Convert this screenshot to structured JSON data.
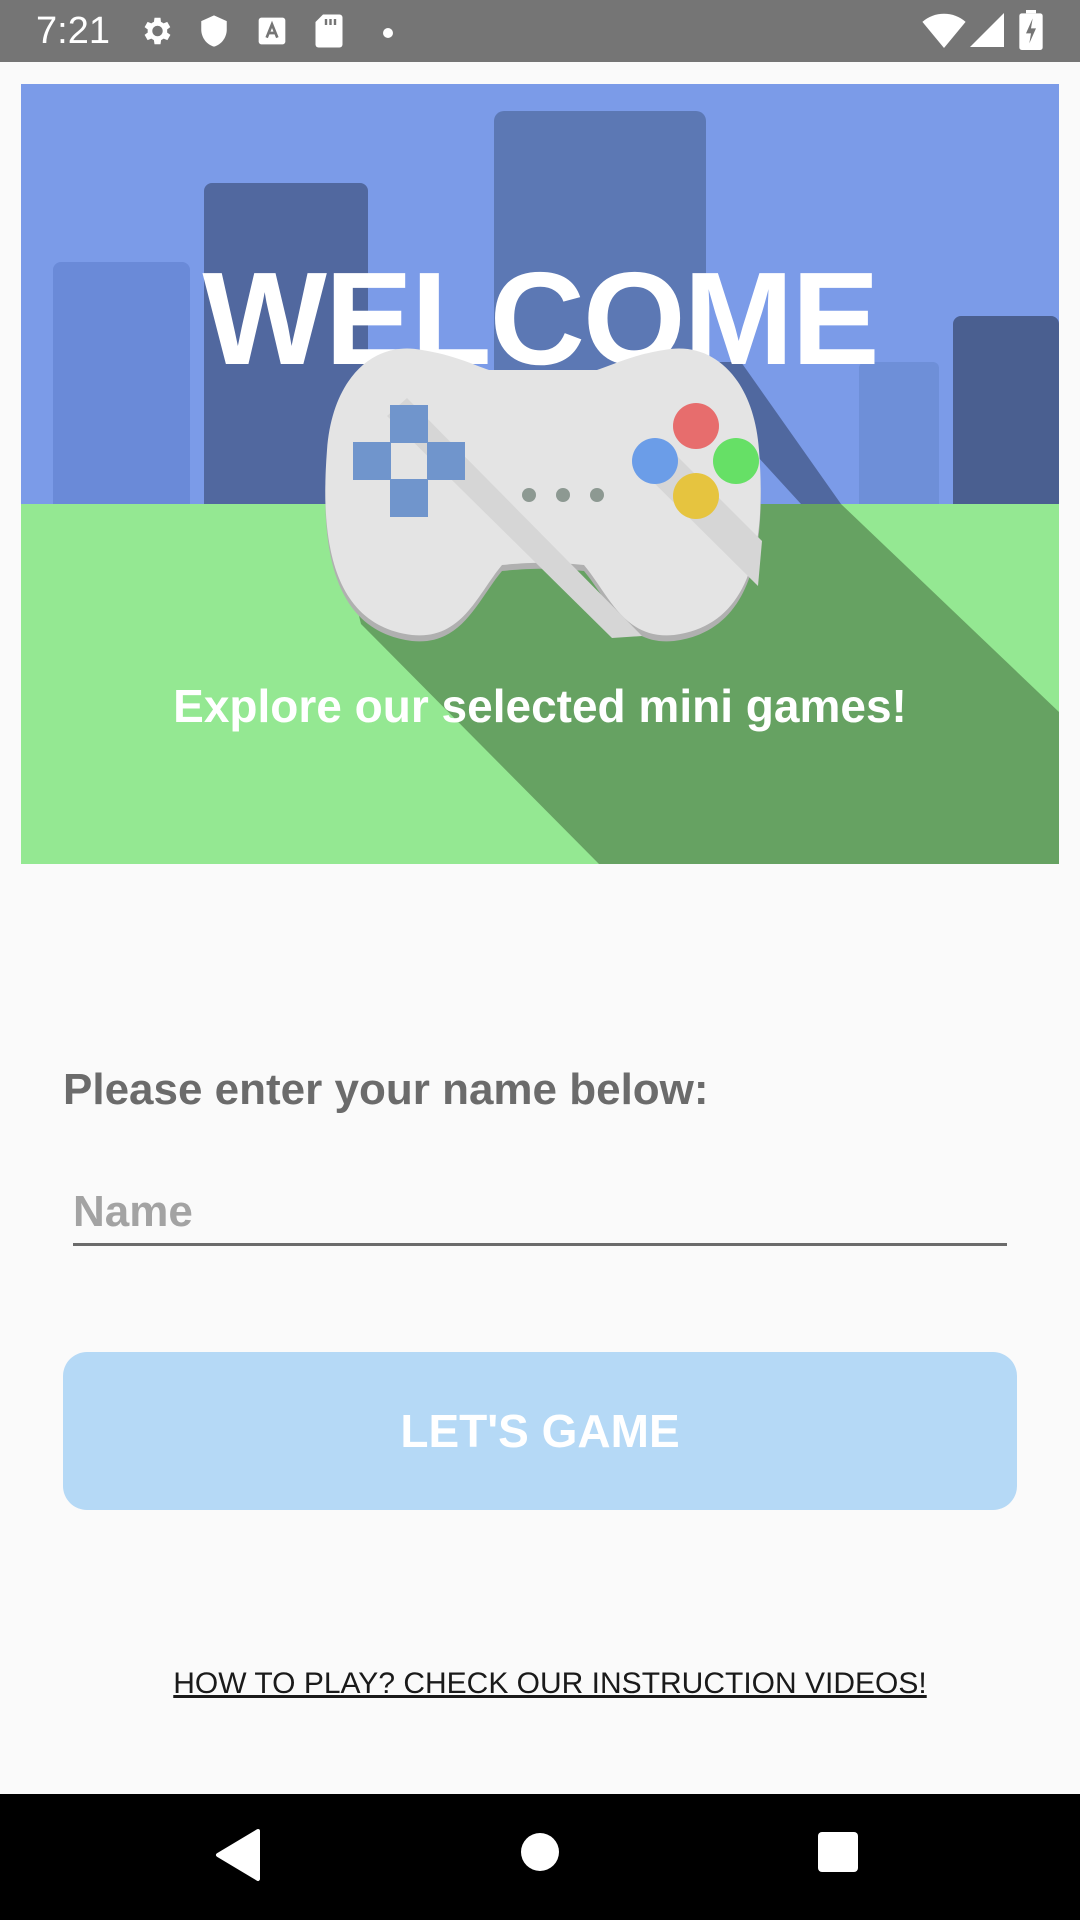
{
  "status_bar": {
    "time": "7:21",
    "left_icons": [
      "gear-icon",
      "shield-icon",
      "font-a-icon",
      "sd-card-icon",
      "dot-icon"
    ],
    "right_icons": [
      "wifi-icon",
      "cell-signal-icon",
      "battery-charging-icon"
    ]
  },
  "hero": {
    "title": "WELCOME",
    "tagline": "Explore our selected mini games!",
    "colors": {
      "sky": "#7b9be8",
      "grass": "#94e892",
      "shadow": "#66a262"
    },
    "illustration": "gamepad-icon"
  },
  "form": {
    "prompt": "Please enter your name below:",
    "name_placeholder": "Name",
    "name_value": "",
    "submit_label": "LET'S GAME",
    "button_color": "#b5d9f6"
  },
  "links": {
    "how_to_play": "HOW TO PLAY? CHECK OUR INSTRUCTION VIDEOS!"
  },
  "nav_bar": {
    "buttons": [
      "back-icon",
      "home-icon",
      "recents-icon"
    ]
  }
}
